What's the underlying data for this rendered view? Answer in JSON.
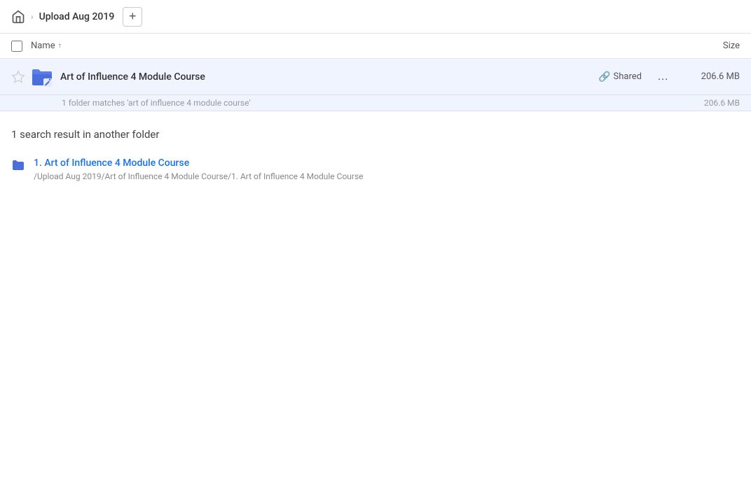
{
  "topbar": {
    "home_label": "Home",
    "title": "Upload Aug 2019",
    "add_button_label": "+"
  },
  "column_header": {
    "checkbox_label": "Select all",
    "name_label": "Name",
    "sort_arrow": "↑",
    "size_label": "Size"
  },
  "main_result": {
    "folder_name": "Art of Influence 4 Module Course",
    "shared_label": "Shared",
    "more_label": "…",
    "size": "206.6 MB",
    "sub_text": "1 folder matches 'art of influence 4 module course'",
    "sub_size": "206.6 MB"
  },
  "another_folder_section": {
    "title": "1 search result in another folder",
    "results": [
      {
        "name": "1. Art of Influence 4 Module Course",
        "path": "/Upload Aug 2019/Art of Influence 4 Module Course/1. Art of Influence 4 Module Course"
      }
    ]
  }
}
